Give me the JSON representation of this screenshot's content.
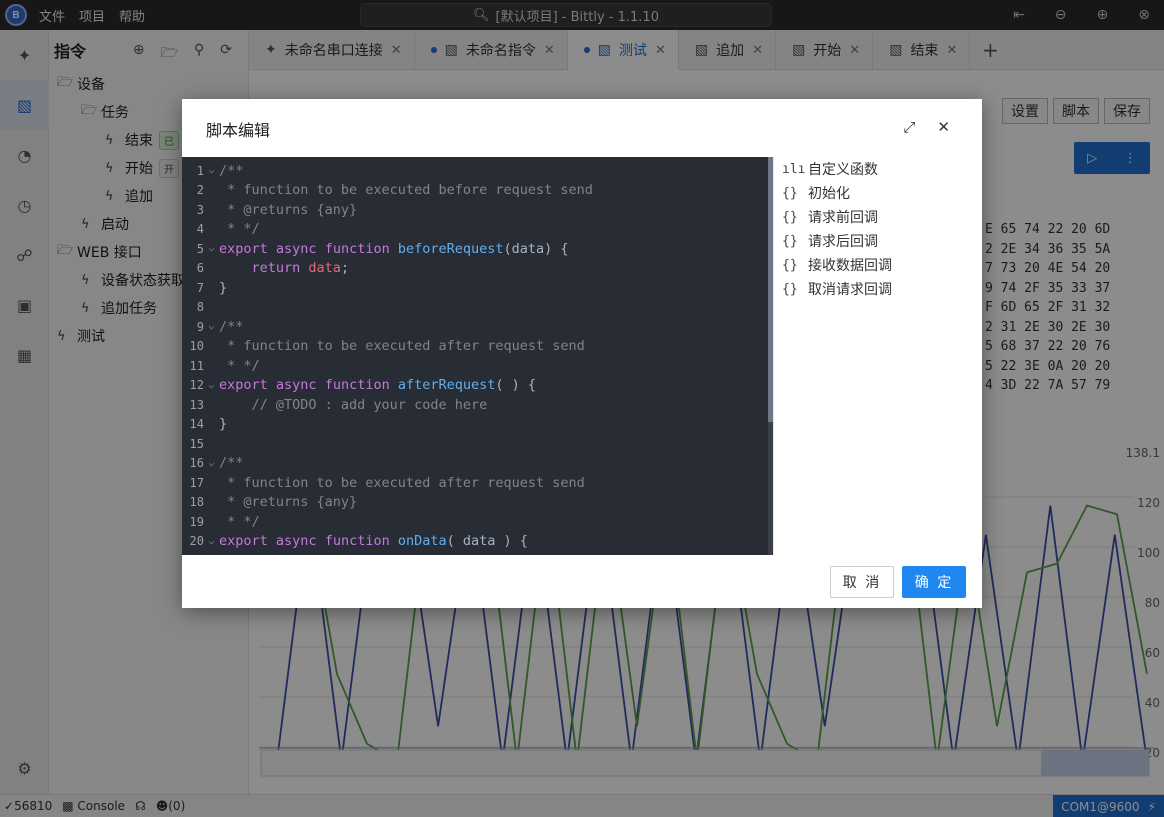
{
  "titlebar": {
    "logo_text": "B",
    "menu": [
      "文件",
      "项目",
      "帮助"
    ],
    "search_text": "[默认项目] - Bittly - 1.1.10"
  },
  "sidebar": {
    "title": "指令",
    "tree": [
      {
        "label": "设备",
        "level": 0,
        "icon": "folder-icon"
      },
      {
        "label": "任务",
        "level": 1,
        "icon": "folder-icon"
      },
      {
        "label": "结束",
        "level": 2,
        "icon": "bolt-icon",
        "badge": "已"
      },
      {
        "label": "开始",
        "level": 2,
        "icon": "bolt-icon",
        "badge": "开"
      },
      {
        "label": "追加",
        "level": 2,
        "icon": "bolt-icon"
      },
      {
        "label": "启动",
        "level": 1,
        "icon": "bolt-icon"
      },
      {
        "label": "WEB 接口",
        "level": 0,
        "icon": "folder-icon"
      },
      {
        "label": "设备状态获取",
        "level": 1,
        "icon": "bolt-icon"
      },
      {
        "label": "追加任务",
        "level": 1,
        "icon": "bolt-icon"
      },
      {
        "label": "测试",
        "level": 0,
        "icon": "bolt-icon"
      }
    ]
  },
  "tabs": [
    {
      "label": "未命名串口连接",
      "icon": "link-icon",
      "active": false,
      "dot": false
    },
    {
      "label": "未命名指令",
      "icon": "command-icon",
      "active": false,
      "dot": true
    },
    {
      "label": "测试",
      "icon": "command-icon",
      "active": true,
      "dot": true
    },
    {
      "label": "追加",
      "icon": "command-icon",
      "active": false,
      "dot": false
    },
    {
      "label": "开始",
      "icon": "command-icon",
      "active": false,
      "dot": false
    },
    {
      "label": "结束",
      "icon": "command-icon",
      "active": false,
      "dot": false
    }
  ],
  "workspace": {
    "buttons": [
      "设置",
      "脚本",
      "保存"
    ],
    "hex_lines": [
      "E 65 74 22 20 6D",
      "2 2E 34 36 35 5A",
      "7 73 20 4E 54 20",
      "9 74 2F 35 33 37",
      "F 6D 65 2F 31 32",
      "2 31 2E 30 2E 30",
      "5 68 37 22 20 76",
      "5 22 3E 0A 20 20",
      "4 3D 22 7A 57 79"
    ],
    "y_ticks": [
      "138.1",
      "120",
      "100",
      "80",
      "60",
      "40",
      "20"
    ]
  },
  "chart_data": {
    "type": "line",
    "y_axis_labels": [
      "138.1",
      "120",
      "100",
      "80",
      "60",
      "40",
      "20"
    ],
    "series": [
      {
        "color": "#3b4fa8",
        "values": [
          32,
          120,
          32,
          120,
          120,
          44,
          120,
          32,
          120,
          32,
          120,
          32,
          120,
          32,
          120,
          32,
          120,
          44,
          120,
          120,
          117,
          32,
          110,
          32,
          120,
          32,
          110,
          32
        ]
      },
      {
        "color": "#5aa04a",
        "values": [
          120,
          120,
          62,
          38,
          32,
          120,
          120,
          120,
          32,
          120,
          32,
          120,
          44,
          120,
          32,
          120,
          62,
          38,
          32,
          120,
          120,
          120,
          32,
          110,
          44,
          97,
          100,
          120,
          117,
          62
        ]
      }
    ]
  },
  "statusbar": {
    "left": [
      "56810",
      "Console",
      "",
      "(0)"
    ],
    "port": "COM1@9600"
  },
  "dialog": {
    "title": "脚本编辑",
    "code_lines": [
      {
        "n": "1",
        "fold": true,
        "parts": [
          [
            "cm",
            "/**"
          ]
        ]
      },
      {
        "n": "2",
        "fold": false,
        "parts": [
          [
            "cm",
            " * function to be executed before request send"
          ]
        ]
      },
      {
        "n": "3",
        "fold": false,
        "parts": [
          [
            "cm",
            " * @returns {any}"
          ]
        ]
      },
      {
        "n": "4",
        "fold": false,
        "parts": [
          [
            "cm",
            " * */"
          ]
        ]
      },
      {
        "n": "5",
        "fold": true,
        "parts": [
          [
            "kw",
            "export "
          ],
          [
            "kw",
            "async "
          ],
          [
            "kw",
            "function "
          ],
          [
            "fn",
            "beforeRequest"
          ],
          [
            "pl",
            "(data) {"
          ]
        ]
      },
      {
        "n": "6",
        "fold": false,
        "parts": [
          [
            "pl",
            "    "
          ],
          [
            "kw",
            "return "
          ],
          [
            "var",
            "data"
          ],
          [
            "pl",
            ";"
          ]
        ]
      },
      {
        "n": "7",
        "fold": false,
        "parts": [
          [
            "pl",
            "}"
          ]
        ]
      },
      {
        "n": "8",
        "fold": false,
        "parts": [
          [
            "pl",
            ""
          ]
        ]
      },
      {
        "n": "9",
        "fold": true,
        "parts": [
          [
            "cm",
            "/**"
          ]
        ]
      },
      {
        "n": "10",
        "fold": false,
        "parts": [
          [
            "cm",
            " * function to be executed after request send"
          ]
        ]
      },
      {
        "n": "11",
        "fold": false,
        "parts": [
          [
            "cm",
            " * */"
          ]
        ]
      },
      {
        "n": "12",
        "fold": true,
        "parts": [
          [
            "kw",
            "export "
          ],
          [
            "kw",
            "async "
          ],
          [
            "kw",
            "function "
          ],
          [
            "fn",
            "afterRequest"
          ],
          [
            "pl",
            "( ) {"
          ]
        ]
      },
      {
        "n": "13",
        "fold": false,
        "parts": [
          [
            "pl",
            "    "
          ],
          [
            "cm",
            "// @TODO : add your code here"
          ]
        ]
      },
      {
        "n": "14",
        "fold": false,
        "parts": [
          [
            "pl",
            "}"
          ]
        ]
      },
      {
        "n": "15",
        "fold": false,
        "parts": [
          [
            "pl",
            ""
          ]
        ]
      },
      {
        "n": "16",
        "fold": true,
        "parts": [
          [
            "cm",
            "/**"
          ]
        ]
      },
      {
        "n": "17",
        "fold": false,
        "parts": [
          [
            "cm",
            " * function to be executed after request send"
          ]
        ]
      },
      {
        "n": "18",
        "fold": false,
        "parts": [
          [
            "cm",
            " * @returns {any}"
          ]
        ]
      },
      {
        "n": "19",
        "fold": false,
        "parts": [
          [
            "cm",
            " * */"
          ]
        ]
      },
      {
        "n": "20",
        "fold": true,
        "parts": [
          [
            "kw",
            "export "
          ],
          [
            "kw",
            "async "
          ],
          [
            "kw",
            "function "
          ],
          [
            "fn",
            "onData"
          ],
          [
            "pl",
            "( data ) {"
          ]
        ]
      }
    ],
    "functions": [
      {
        "label": "自定义函数",
        "icon": "waveform-icon",
        "glyph": "ılı"
      },
      {
        "label": "初始化",
        "icon": "braces-icon",
        "glyph": "{}"
      },
      {
        "label": "请求前回调",
        "icon": "braces-icon",
        "glyph": "{}"
      },
      {
        "label": "请求后回调",
        "icon": "braces-icon",
        "glyph": "{}"
      },
      {
        "label": "接收数据回调",
        "icon": "braces-icon",
        "glyph": "{}"
      },
      {
        "label": "取消请求回调",
        "icon": "braces-icon",
        "glyph": "{}"
      }
    ],
    "cancel_label": "取 消",
    "ok_label": "确 定"
  }
}
